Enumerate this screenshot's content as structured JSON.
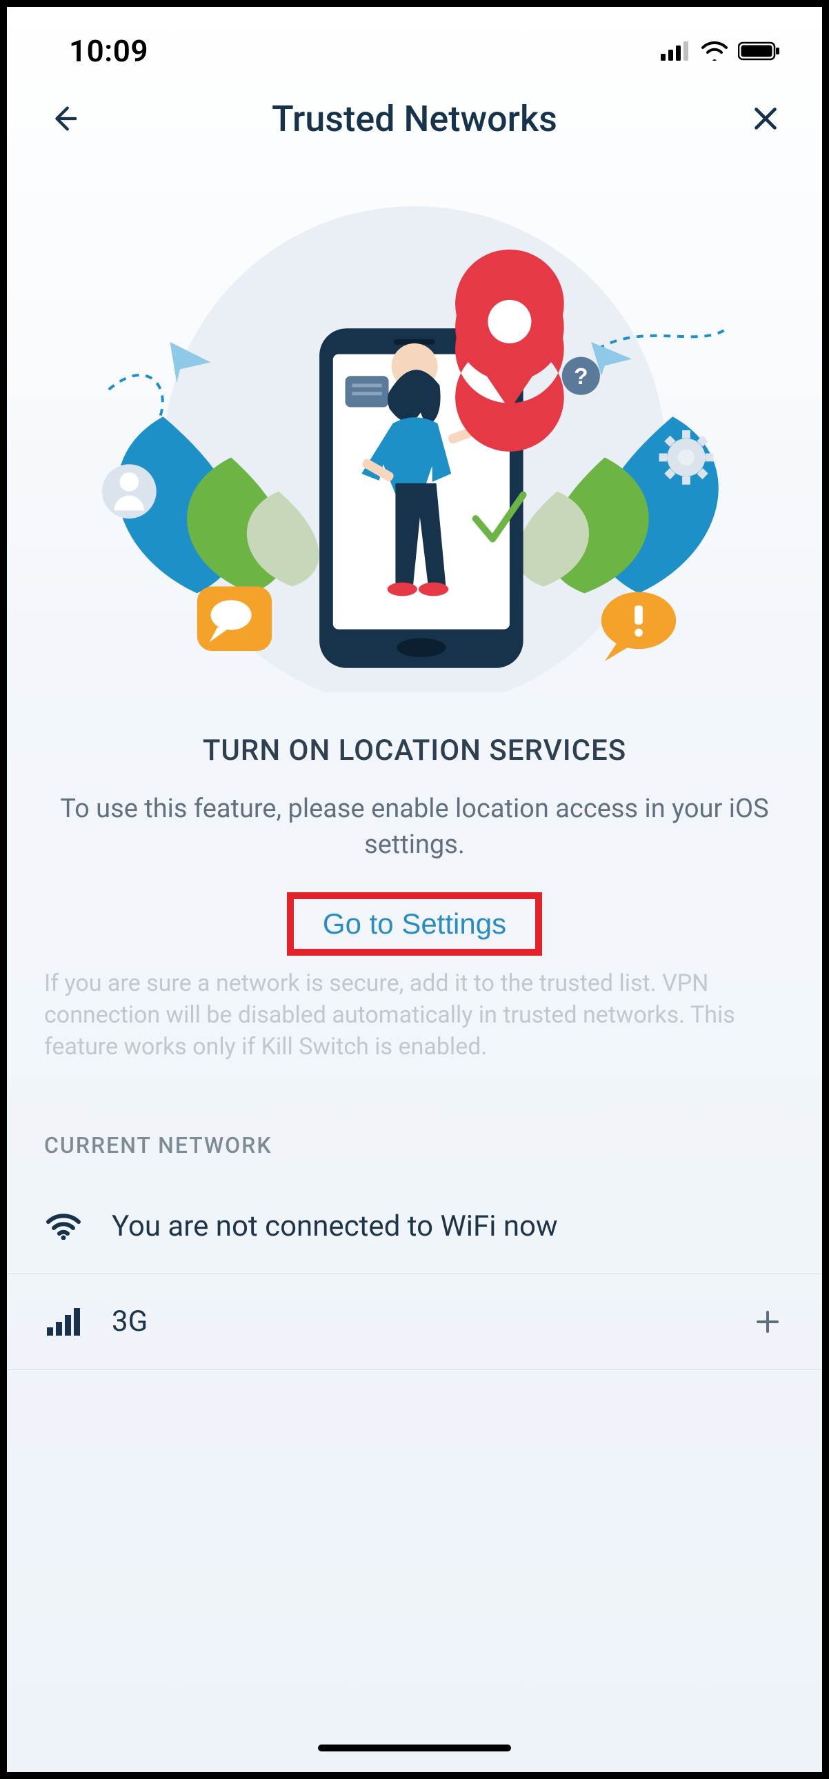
{
  "statusbar": {
    "time": "10:09"
  },
  "nav": {
    "title": "Trusted Networks"
  },
  "prompt": {
    "heading": "TURN ON LOCATION SERVICES",
    "description": "To use this feature, please enable location access in your iOS settings.",
    "settings_button": "Go to Settings"
  },
  "info_paragraph": "If you are sure a network is secure, add it to the trusted list. VPN connection will be disabled automatically in trusted networks. This feature works only if Kill Switch is enabled.",
  "sections": {
    "current_network": {
      "header": "CURRENT NETWORK",
      "rows": [
        {
          "icon": "wifi-icon",
          "label": "You are not connected to WiFi now",
          "has_add": false
        },
        {
          "icon": "cellular-icon",
          "label": "3G",
          "has_add": true
        }
      ]
    }
  },
  "colors": {
    "accent_red": "#e63946",
    "accent_blue": "#1e90c8",
    "accent_green": "#6cb545",
    "accent_orange": "#f4a229",
    "wave_blue": "#1e90c8",
    "wave_green": "#6cb545",
    "text_primary": "#17324b",
    "link": "#2b8cc3",
    "highlight_box": "#e2242a"
  }
}
